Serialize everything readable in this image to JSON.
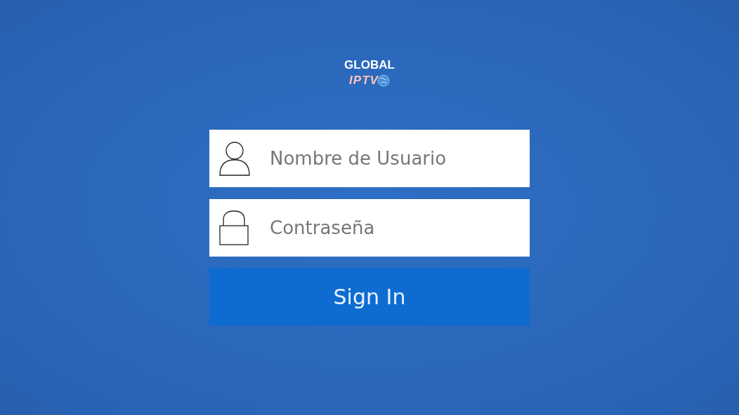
{
  "logo": {
    "top_text": "GLOBAL",
    "brand_text": "IPTV"
  },
  "fields": [
    {
      "kind": "user",
      "placeholder": "Nombre de Usuario"
    },
    {
      "kind": "password",
      "placeholder": "Contraseña"
    }
  ],
  "sign_in_button": "Sign In"
}
